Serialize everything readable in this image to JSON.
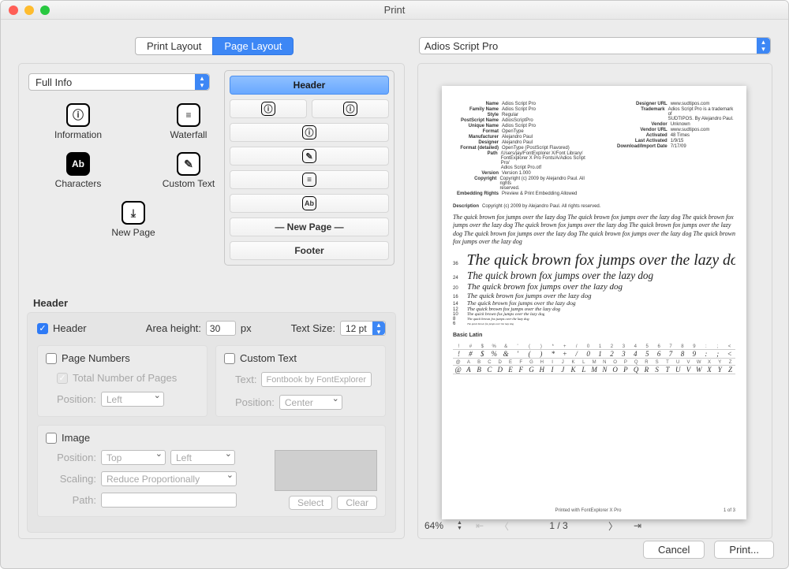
{
  "window": {
    "title": "Print"
  },
  "tabs": {
    "print_layout": "Print Layout",
    "page_layout": "Page Layout"
  },
  "font_dropdown": {
    "selected": "Adios Script Pro"
  },
  "left": {
    "fullinfo": "Full Info",
    "icons": {
      "information": "Information",
      "waterfall": "Waterfall",
      "characters": "Characters",
      "custom_text": "Custom Text",
      "new_page": "New Page"
    }
  },
  "stack": {
    "header": "Header",
    "new_page": "—  New Page  —",
    "footer": "Footer"
  },
  "header_settings": {
    "section_label": "Header",
    "enable_label": "Header",
    "area_height_label": "Area height:",
    "area_height_val": "30",
    "px": "px",
    "text_size_label": "Text Size:",
    "text_size_val": "12 pt",
    "page_numbers": "Page Numbers",
    "total_pages": "Total Number of Pages",
    "position_label": "Position:",
    "pos_left": "Left",
    "custom_text": "Custom Text",
    "text_label": "Text:",
    "text_value": "Fontbook by FontExplorer",
    "pos_center": "Center",
    "image": "Image",
    "pos_top": "Top",
    "scaling_label": "Scaling:",
    "scaling_val": "Reduce Proportionally",
    "path_label": "Path:",
    "select": "Select",
    "clear": "Clear"
  },
  "preview": {
    "zoom": "64%",
    "page_indicator": "1 / 3",
    "footer_center": "Printed with FontExplorer X Pro",
    "footer_right": "1 of 3",
    "waterfall_text": "The quick brown fox jumps over the lazy dog",
    "waterfall_sizes": [
      "36",
      "24",
      "20",
      "16",
      "14",
      "12",
      "10",
      "8",
      "6"
    ],
    "basic_latin_label": "Basic Latin",
    "desc_label": "Description",
    "desc_text": "Copyright (c) 2009 by Alejandro Paul. All rights reserved.",
    "left_fields": [
      {
        "k": "Name",
        "v": "Adios Script Pro"
      },
      {
        "k": "Family Name",
        "v": "Adios Script Pro"
      },
      {
        "k": "Style",
        "v": "Regular"
      },
      {
        "k": "PostScript Name",
        "v": "AdiosScriptPro"
      },
      {
        "k": "Unique Name",
        "v": "Adios Script Pro"
      },
      {
        "k": "Format",
        "v": "OpenType"
      },
      {
        "k": "Manufacturer",
        "v": "Alejandro Paul"
      },
      {
        "k": "Designer",
        "v": "Alejandro Paul"
      },
      {
        "k": "Format (detailed)",
        "v": "OpenType (PostScript Flavored)"
      },
      {
        "k": "Path",
        "v": "/Users/jay/FontExplorer X/Font Library/\nFontExplorer X Pro Fonts/A/Adios Script Pro/\nAdios Script Pro.otf"
      },
      {
        "k": "Version",
        "v": "Version 1.000"
      },
      {
        "k": "Copyright",
        "v": "Copyright (c) 2009 by Alejandro Paul. All rights\nreserved."
      },
      {
        "k": "Embedding Rights",
        "v": "Preview & Print Embedding Allowed"
      }
    ],
    "right_fields": [
      {
        "k": "Designer URL",
        "v": "www.sudtipos.com"
      },
      {
        "k": "Trademark",
        "v": "Adios Script Pro is a trademark of\nSUDTIPOS. By Alejandro Paul."
      },
      {
        "k": "Vendor",
        "v": "Unknown"
      },
      {
        "k": "Vendor URL",
        "v": "www.sudtipos.com"
      },
      {
        "k": "Activated",
        "v": "48 Times"
      },
      {
        "k": "Last Activated",
        "v": "1/9/15"
      },
      {
        "k": "Download/Import Date",
        "v": "7/17/09"
      }
    ],
    "char_headers": [
      "!",
      "#",
      "$",
      "%",
      "&",
      "'",
      "(",
      ")",
      "*",
      "+",
      "/",
      "0",
      "1",
      "2",
      "3",
      "4",
      "5",
      "6",
      "7",
      "8",
      "9",
      ":",
      ";",
      "<"
    ],
    "char_letters": [
      "@",
      "A",
      "B",
      "C",
      "D",
      "E",
      "F",
      "G",
      "H",
      "I",
      "J",
      "K",
      "L",
      "M",
      "N",
      "O",
      "P",
      "Q",
      "R",
      "S",
      "T",
      "U",
      "V",
      "W",
      "X",
      "Y",
      "Z"
    ]
  },
  "buttons": {
    "cancel": "Cancel",
    "print": "Print..."
  }
}
